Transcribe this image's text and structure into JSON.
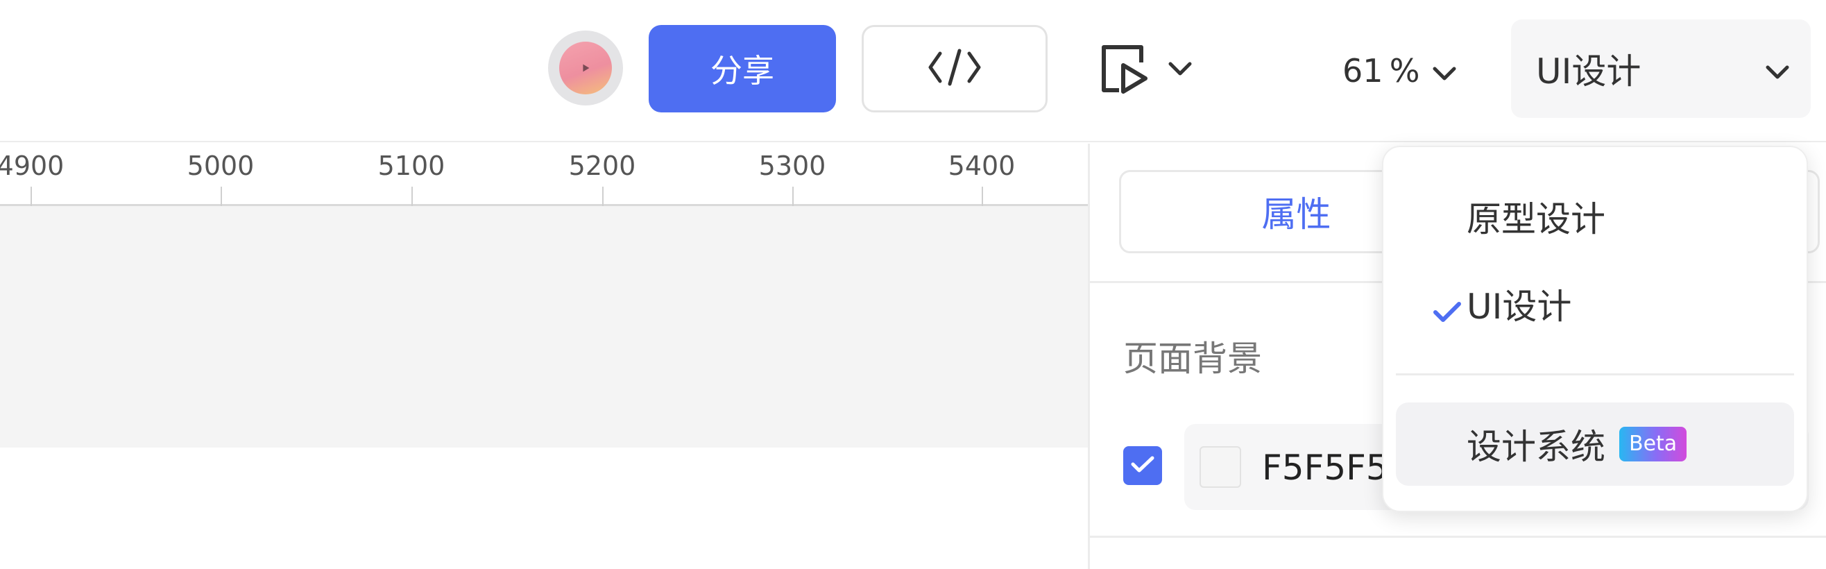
{
  "toolbar": {
    "share_label": "分享",
    "zoom_value": "61",
    "zoom_unit": "%",
    "mode_selected": "UI设计"
  },
  "ruler": {
    "ticks": [
      "4900",
      "5000",
      "5100",
      "5200",
      "5300",
      "5400"
    ]
  },
  "panel": {
    "tab_properties": "属性",
    "section_page_background": "页面背景",
    "background_enabled": true,
    "background_color": "F5F5F5"
  },
  "mode_dropdown": {
    "items": [
      {
        "label": "原型设计",
        "selected": false
      },
      {
        "label": "UI设计",
        "selected": true
      },
      {
        "label": "设计系统",
        "badge": "Beta",
        "selected": false
      }
    ]
  },
  "colors": {
    "accent": "#4e6ef2",
    "artboard_background": "#F5F5F5"
  },
  "icons": {
    "avatar": "avatar-icon",
    "code": "code-icon",
    "preview": "play-preview-icon",
    "chevron": "chevron-down-icon",
    "check": "check-icon"
  }
}
